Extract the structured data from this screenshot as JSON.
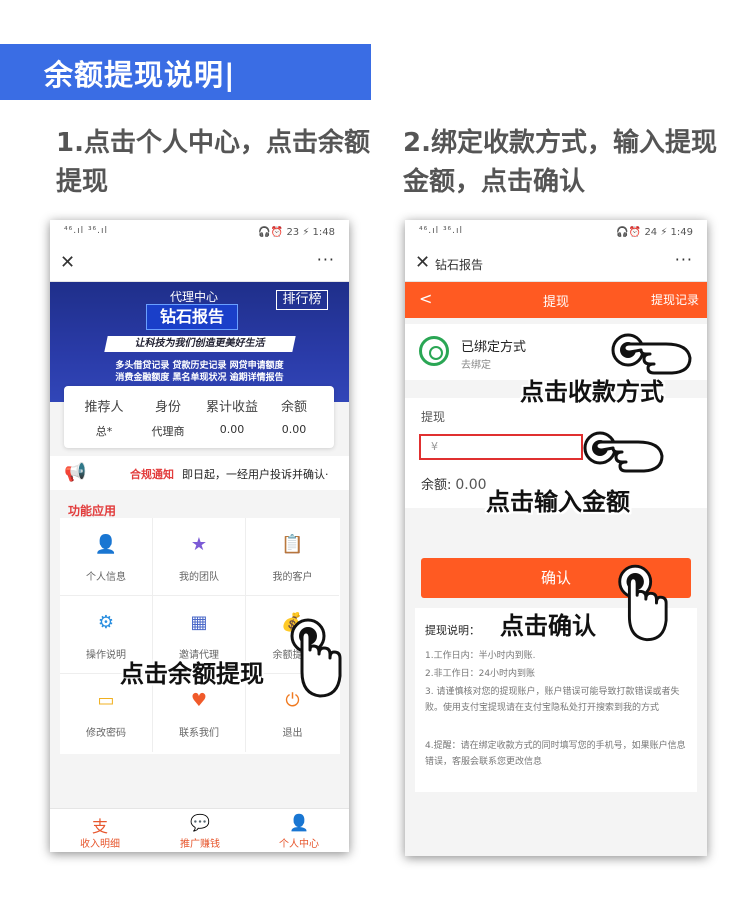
{
  "header": {
    "title": "余额提现说明|"
  },
  "steps": [
    {
      "text": "1.点击个人中心，点击余额提现"
    },
    {
      "text": "2.绑定收款方式，输入提现金额，点击确认"
    }
  ],
  "phone1": {
    "status": {
      "signal": "⁴⁶.ıl ³⁶.ıl",
      "right": "🎧⏰ 23 ⚡ 1:48"
    },
    "close": "✕",
    "more": "···",
    "banner": {
      "agent_center": "代理中心",
      "report_title": "钻石报告",
      "rank": "排行榜",
      "slogan": "让科技为我们创造更美好生活",
      "line1": "多头借贷记录 贷款历史记录 网贷申请额度",
      "line2": "消费金融额度 黑名单现状况 逾期详情报告"
    },
    "stats": [
      {
        "label": "推荐人",
        "value": "总*"
      },
      {
        "label": "身份",
        "value": "代理商"
      },
      {
        "label": "累计收益",
        "value": "0.00"
      },
      {
        "label": "余额",
        "value": "0.00"
      }
    ],
    "notice": {
      "title": "合规通知",
      "text": "即日起，一经用户投诉并确认·"
    },
    "section_title": "功能应用",
    "grid": [
      {
        "label": "个人信息",
        "icon": "👤"
      },
      {
        "label": "我的团队",
        "icon": "★"
      },
      {
        "label": "我的客户",
        "icon": "📋"
      },
      {
        "label": "操作说明",
        "icon": "⚙"
      },
      {
        "label": "邀请代理",
        "icon": "▦"
      },
      {
        "label": "余额提现",
        "icon": "💰"
      },
      {
        "label": "修改密码",
        "icon": "▭"
      },
      {
        "label": "联系我们",
        "icon": "♥"
      },
      {
        "label": "退出",
        "icon": "⏻"
      }
    ],
    "tabs": [
      {
        "label": "收入明细",
        "icon": "支"
      },
      {
        "label": "推广赚钱",
        "icon": "💬"
      },
      {
        "label": "个人中心",
        "icon": "👤"
      }
    ],
    "overlay": "点击余额提现"
  },
  "phone2": {
    "status": {
      "signal": "⁴⁶.ıl ³⁶.ıl",
      "right": "🎧⏰ 24 ⚡ 1:49"
    },
    "close": "✕",
    "page_title": "钻石报告",
    "more": "···",
    "nav": {
      "back": "<",
      "title": "提现",
      "records": "提现记录"
    },
    "bound": {
      "title": "已绑定方式",
      "subtitle": "去绑定"
    },
    "amount": {
      "label": "提现",
      "placeholder": "¥",
      "balance_label": "余额:",
      "balance_value": "0.00"
    },
    "confirm_label": "确认",
    "explain": {
      "title": "提现说明：",
      "items": [
        "1.工作日内：半小时内到账.",
        "2.非工作日：24小时内到账",
        "3. 请谨慎核对您的提现账户，账户错误可能导致打款错误或者失败。使用支付宝提现请在支付宝隐私处打开搜索到我的方式",
        "4.提醒：请在绑定收款方式的同时填写您的手机号，如果账户信息错误，客服会联系您更改信息"
      ]
    },
    "overlays": {
      "method": "点击收款方式",
      "amount": "点击输入金额",
      "confirm": "点击确认"
    }
  },
  "colors": {
    "brand_blue": "#3a6de4",
    "accent_orange": "#ff5a22",
    "alert_red": "#e23c3c"
  }
}
